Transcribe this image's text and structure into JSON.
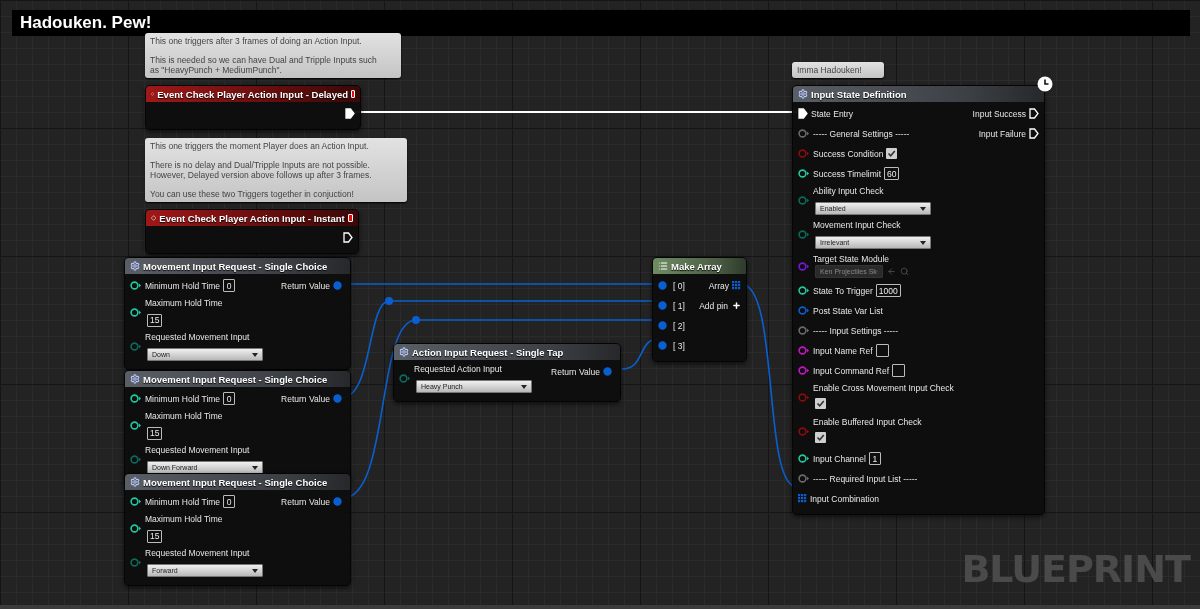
{
  "graph": {
    "comment_box": {
      "title": "Hadouken. Pew!"
    },
    "nodes": [
      {
        "kind": "event",
        "title": "Event Check Player Action Input - Delayed",
        "delegate_pin": true,
        "comment": [
          "This one triggers after 3 frames of doing an Action Input.",
          "This is needed so we can have Dual and Tripple Inputs such as \"HeavyPunch + MediumPunch\"."
        ],
        "outputs": [
          {
            "kind": "exec",
            "connected": true
          }
        ]
      },
      {
        "kind": "event",
        "title": "Event Check Player Action Input - Instant",
        "delegate_pin": true,
        "comment": [
          "This one triggers the moment Player does an Action Input.",
          "There is no delay and Dual/Tripple Inputs are not possible. However, Delayed version above follows up after 3 frames.",
          "You can use these two Triggers together in conjuction!"
        ],
        "outputs": [
          {
            "kind": "exec",
            "connected": false
          }
        ]
      },
      {
        "kind": "function",
        "title": "Movement Input Request - Single Choice",
        "inputs": [
          {
            "kind": "int",
            "label": "Minimum Hold Time",
            "connected": false,
            "value": "0"
          },
          {
            "kind": "int",
            "label": "Maximum Hold Time",
            "connected": false,
            "value": "15",
            "wrapped": true
          },
          {
            "kind": "enum",
            "label": "Requested Movement Input",
            "connected": false,
            "value": "Down"
          }
        ],
        "outputs": [
          {
            "kind": "struct",
            "label": "Return Value",
            "connected": true
          }
        ]
      },
      {
        "kind": "function",
        "title": "Movement Input Request - Single Choice",
        "inputs": [
          {
            "kind": "int",
            "label": "Minimum Hold Time",
            "connected": false,
            "value": "0"
          },
          {
            "kind": "int",
            "label": "Maximum Hold Time",
            "connected": false,
            "value": "15",
            "wrapped": true
          },
          {
            "kind": "enum",
            "label": "Requested Movement Input",
            "connected": false,
            "value": "Down Forward"
          }
        ],
        "outputs": [
          {
            "kind": "struct",
            "label": "Return Value",
            "connected": true
          }
        ]
      },
      {
        "kind": "function",
        "title": "Movement Input Request - Single Choice",
        "inputs": [
          {
            "kind": "int",
            "label": "Minimum Hold Time",
            "connected": false,
            "value": "0"
          },
          {
            "kind": "int",
            "label": "Maximum Hold Time",
            "connected": false,
            "value": "15",
            "wrapped": true
          },
          {
            "kind": "enum",
            "label": "Requested Movement Input",
            "connected": false,
            "value": "Forward"
          }
        ],
        "outputs": [
          {
            "kind": "struct",
            "label": "Return Value",
            "connected": true
          }
        ]
      },
      {
        "kind": "function",
        "title": "Action Input Request - Single Tap",
        "inputs": [
          {
            "kind": "enum",
            "label": "Requested Action Input",
            "connected": false,
            "value": "Heavy Punch"
          }
        ],
        "outputs": [
          {
            "kind": "struct",
            "label": "Return Value",
            "connected": true
          }
        ]
      },
      {
        "kind": "make_array",
        "title": "Make Array",
        "inputs": [
          {
            "kind": "struct",
            "label": "[ 0]",
            "connected": true
          },
          {
            "kind": "struct",
            "label": "[ 1]",
            "connected": true
          },
          {
            "kind": "struct",
            "label": "[ 2]",
            "connected": true
          },
          {
            "kind": "struct",
            "label": "[ 3]",
            "connected": true
          }
        ],
        "outputs": [
          {
            "kind": "array",
            "label": "Array",
            "connected": true
          },
          {
            "kind": "add_pin",
            "label": "Add pin"
          }
        ]
      },
      {
        "kind": "function",
        "title": "Input State Definition",
        "latent": true,
        "comment": [
          "Imma Hadouken!"
        ],
        "inputs": [
          {
            "kind": "exec",
            "label": "State Entry",
            "connected": true
          },
          {
            "kind": "wildcard",
            "label": "----- General Settings -----",
            "connected": false
          },
          {
            "kind": "bool",
            "label": "Success Condition",
            "connected": false,
            "checked": true
          },
          {
            "kind": "int",
            "label": "Success Timelimit",
            "connected": false,
            "value": "60"
          },
          {
            "kind": "enum",
            "label": "Ability Input Check",
            "connected": false,
            "value": "Enabled"
          },
          {
            "kind": "enum",
            "label": "Movement Input Check",
            "connected": false,
            "value": "Irrelevant"
          },
          {
            "kind": "object",
            "label": "Target State Module",
            "connected": false,
            "value": "Ken Projectiles Sk"
          },
          {
            "kind": "int",
            "label": "State To Trigger",
            "connected": false,
            "value": "1000"
          },
          {
            "kind": "struct",
            "label": "Post State Var List",
            "connected": false
          },
          {
            "kind": "wildcard",
            "label": "----- Input Settings -----",
            "connected": false
          },
          {
            "kind": "name",
            "label": "Input Name Ref",
            "connected": false
          },
          {
            "kind": "name",
            "label": "Input Command Ref",
            "connected": false
          },
          {
            "kind": "bool",
            "label": "Enable Cross Movement Input Check",
            "connected": false,
            "checked": true,
            "wrapped": true
          },
          {
            "kind": "bool",
            "label": "Enable Buffered Input Check",
            "connected": false,
            "checked": true,
            "wrapped": true
          },
          {
            "kind": "int",
            "label": "Input Channel",
            "connected": false,
            "value": "1"
          },
          {
            "kind": "wildcard",
            "label": "----- Required Input List -----",
            "connected": false
          },
          {
            "kind": "array",
            "label": "Input Combination",
            "connected": true
          }
        ],
        "outputs": [
          {
            "kind": "exec",
            "label": "Input Success",
            "connected": false
          },
          {
            "kind": "exec",
            "label": "Input Failure",
            "connected": false
          }
        ]
      }
    ],
    "graph_label": "BLUEPRINT"
  }
}
